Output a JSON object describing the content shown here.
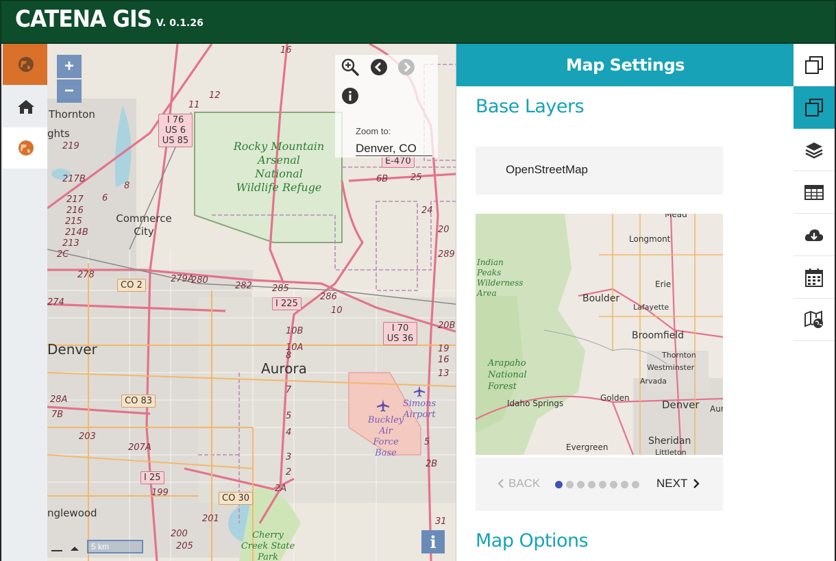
{
  "header": {
    "title": "CATENA GIS",
    "version": "V. 0.1.26"
  },
  "colors": {
    "header_bg": "#0e4d2c",
    "accent": "#17a2b8",
    "orange": "#d9712b"
  },
  "left_sidebar": {
    "items": [
      {
        "icon": "globe-icon",
        "state": "highlighted"
      },
      {
        "icon": "home-icon",
        "state": "normal"
      },
      {
        "icon": "globe-icon",
        "state": "active"
      }
    ]
  },
  "map": {
    "zoom_in": "+",
    "zoom_out": "−",
    "zoom_to_label": "Zoom to:",
    "zoom_to_value": "Denver, CO",
    "scale": "5 km",
    "info": "i",
    "labels": {
      "thornton": "Thornton",
      "ghts": "ghts",
      "commerce_city": "Commerce City",
      "denver": "Denver",
      "aurora": "Aurora",
      "englewood": "nglewood",
      "park": "Rocky Mountain Arsenal National Wildlife Refuge",
      "buckley": "Buckley Air Force Base",
      "simons": "Simons Airport",
      "cherry": "Cherry Creek State Park"
    },
    "shields": {
      "i76": "I 76 US 6 US 85",
      "e470": "E-470",
      "co2": "CO 2",
      "i225": "I 225",
      "i70": "I 70 US 36",
      "co83": "CO 83",
      "i25": "I 25",
      "co30": "CO 30"
    },
    "route_numbers": [
      "16",
      "12",
      "11",
      "8",
      "6",
      "219",
      "217B",
      "217",
      "216",
      "215",
      "214B",
      "213",
      "2C",
      "274",
      "278",
      "279A",
      "280",
      "282",
      "285",
      "286",
      "10",
      "10B",
      "10A",
      "8",
      "7",
      "5",
      "4",
      "3",
      "2",
      "2A",
      "201",
      "199",
      "200",
      "205",
      "203",
      "207A",
      "7B",
      "28A",
      "6B",
      "25",
      "24",
      "20",
      "289",
      "20B",
      "19",
      "16",
      "13",
      "5",
      "2B",
      "31"
    ]
  },
  "panel": {
    "title": "Map Settings",
    "base_layers_title": "Base Layers",
    "layer_name": "OpenStreetMap",
    "preview_labels": {
      "mead": "Mead",
      "longmont": "Longmont",
      "indian": "Indian Peaks Wilderness Area",
      "boulder": "Boulder",
      "erie": "Erie",
      "lafayette": "Lafayette",
      "broomfield": "Broomfield",
      "thornton": "Thornton",
      "westminster": "Westminster",
      "arvada": "Arvada",
      "arapaho": "Arapaho National Forest",
      "golden": "Golden",
      "idaho": "Idaho Springs",
      "denver": "Denver",
      "aur": "Aur",
      "evergreen": "Evergreen",
      "sheridan": "Sheridan",
      "littleton": "Littleton"
    },
    "back_label": "BACK",
    "next_label": "NEXT",
    "page_count": 8,
    "page_index": 0,
    "map_options_title": "Map Options"
  },
  "right_toolbar": {
    "items": [
      "square-stack-icon",
      "square-stack-icon",
      "layers-icon",
      "table-icon",
      "cloud-download-icon",
      "calendar-icon",
      "map-globe-icon"
    ]
  }
}
